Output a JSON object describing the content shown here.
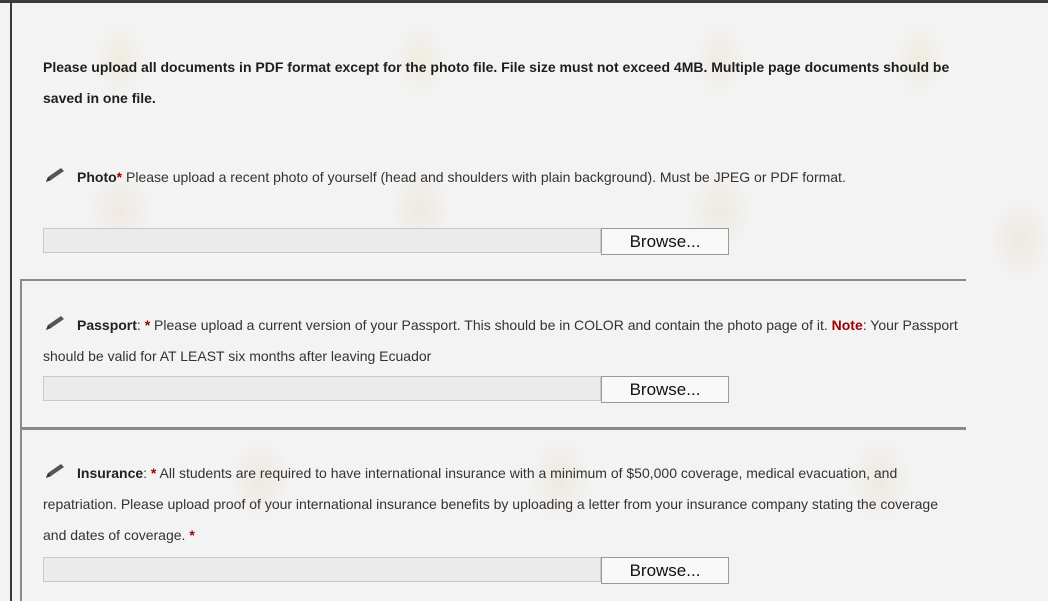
{
  "intro": "Please upload all documents in PDF format except for the photo file. File size must not exceed 4MB. Multiple page documents should be saved in one file.",
  "sections": [
    {
      "title": "Photo",
      "required_mark": "*",
      "text": " Please upload a recent photo of yourself (head and shoulders with plain background). Must be JPEG or PDF format.",
      "browse_label": "Browse..."
    },
    {
      "title": "Passport",
      "colon": ": ",
      "required_mark": "*",
      "text": " Please upload a current version of your Passport. This should be in COLOR and contain the photo page of it. ",
      "note_label": "Note",
      "note_text": ": Your Passport should be valid for AT LEAST six months after leaving Ecuador",
      "browse_label": "Browse..."
    },
    {
      "title": "Insurance",
      "colon": ": ",
      "required_mark": "*",
      "text": " All students are required to have international insurance with a minimum of $50,000 coverage, medical evacuation, and repatriation. Please upload proof of your international insurance benefits by uploading a letter from your insurance company stating the coverage and dates of coverage. ",
      "required_mark_end": "*",
      "browse_label": "Browse..."
    }
  ],
  "icons": {
    "edit": "pencil-icon"
  },
  "colors": {
    "required": "#a00000",
    "background": "#f3f3f3"
  }
}
